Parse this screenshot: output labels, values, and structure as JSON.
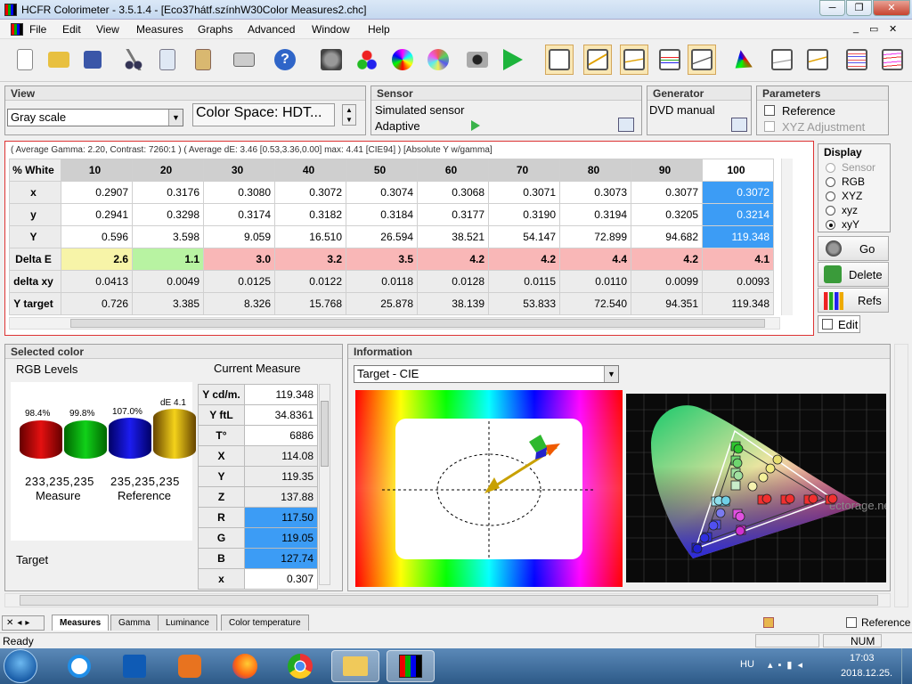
{
  "window": {
    "title": "HCFR Colorimeter - 3.5.1.4 - [Eco37hátf.színhW30Color Measures2.chc]",
    "min": "─",
    "max": "❐",
    "close": "✕",
    "sub_min": "_",
    "sub_max": "▭",
    "sub_close": "✕"
  },
  "menu": [
    "File",
    "Edit",
    "View",
    "Measures",
    "Graphs",
    "Advanced",
    "Window",
    "Help"
  ],
  "view": {
    "title": "View",
    "mode": "Gray scale",
    "colorspace": "Color Space: HDT..."
  },
  "sensor": {
    "title": "Sensor",
    "name": "Simulated sensor",
    "mode": "Adaptive"
  },
  "generator": {
    "title": "Generator",
    "name": "DVD manual"
  },
  "parameters": {
    "title": "Parameters",
    "reference": "Reference",
    "xyz_adj": "XYZ Adjustment"
  },
  "summary": "( Average Gamma: 2.20, Contrast: 7260:1 ) ( Average dE: 3.46 [0.53,3.36,0.00] max: 4.41 [CIE94] ) [Absolute Y w/gamma]",
  "grid": {
    "corner": "% White",
    "cols": [
      "10",
      "20",
      "30",
      "40",
      "50",
      "60",
      "70",
      "80",
      "90",
      "100"
    ],
    "rows": [
      {
        "label": "x",
        "v": [
          "0.2907",
          "0.3176",
          "0.3080",
          "0.3072",
          "0.3074",
          "0.3068",
          "0.3071",
          "0.3073",
          "0.3077",
          "0.3072"
        ]
      },
      {
        "label": "y",
        "v": [
          "0.2941",
          "0.3298",
          "0.3174",
          "0.3182",
          "0.3184",
          "0.3177",
          "0.3190",
          "0.3194",
          "0.3205",
          "0.3214"
        ]
      },
      {
        "label": "Y",
        "v": [
          "0.596",
          "3.598",
          "9.059",
          "16.510",
          "26.594",
          "38.521",
          "54.147",
          "72.899",
          "94.682",
          "119.348"
        ]
      },
      {
        "label": "Delta E",
        "v": [
          "2.6",
          "1.1",
          "3.0",
          "3.2",
          "3.5",
          "4.2",
          "4.2",
          "4.4",
          "4.2",
          "4.1"
        ]
      },
      {
        "label": "delta xy",
        "v": [
          "0.0413",
          "0.0049",
          "0.0125",
          "0.0122",
          "0.0118",
          "0.0128",
          "0.0115",
          "0.0110",
          "0.0099",
          "0.0093"
        ]
      },
      {
        "label": "Y target",
        "v": [
          "0.726",
          "3.385",
          "8.326",
          "15.768",
          "25.878",
          "38.139",
          "53.833",
          "72.540",
          "94.351",
          "119.348"
        ]
      }
    ]
  },
  "display": {
    "title": "Display",
    "options": [
      "Sensor",
      "RGB",
      "XYZ",
      "xyz",
      "xyY"
    ],
    "selected": "xyY"
  },
  "actions": {
    "go": "Go",
    "delete": "Delete",
    "refs": "Refs",
    "edit": "Edit"
  },
  "selected": {
    "title": "Selected color",
    "rgb_levels": "RGB Levels",
    "current": "Current Measure",
    "bars": [
      {
        "label": "98.4%",
        "color": "#e41010"
      },
      {
        "label": "99.8%",
        "color": "#11d019"
      },
      {
        "label": "107.0%",
        "color": "#1c1cf0"
      },
      {
        "label": "dE 4.1",
        "color": "#f4d21a"
      }
    ],
    "measure_val": "233,235,235",
    "measure_label": "Measure",
    "ref_val": "235,235,235",
    "ref_label": "Reference",
    "target": "Target",
    "table": [
      [
        "Y cd/m.",
        "119.348"
      ],
      [
        "Y ftL",
        "34.8361"
      ],
      [
        "T°",
        "6886"
      ],
      [
        "X",
        "114.08"
      ],
      [
        "Y",
        "119.35"
      ],
      [
        "Z",
        "137.88"
      ],
      [
        "R",
        "117.50"
      ],
      [
        "G",
        "119.05"
      ],
      [
        "B",
        "127.74"
      ],
      [
        "x",
        "0.307"
      ]
    ]
  },
  "info": {
    "title": "Information",
    "select": "Target - CIE",
    "watermark": "ectorage.net"
  },
  "tabs": [
    "Measures",
    "Gamma",
    "Luminance",
    "Color temperature"
  ],
  "bottom_ref": "Reference",
  "status": {
    "text": "Ready",
    "num": "NUM"
  },
  "tray": {
    "lang": "HU",
    "time": "17:03",
    "date": "2018.12.25."
  }
}
